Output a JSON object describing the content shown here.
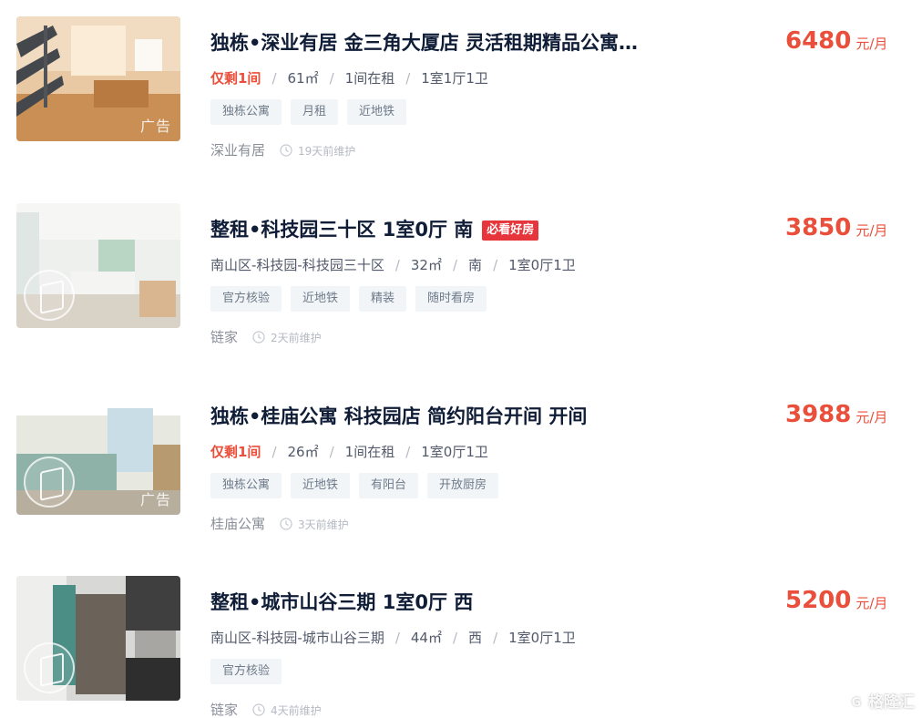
{
  "listings": [
    {
      "title": "独栋•深业有居 金三角大厦店 灵活租期精品公寓…",
      "badge": "",
      "desc_lead": "仅剩1间",
      "desc_parts": [
        "61㎡",
        "1间在租",
        "1室1厅1卫"
      ],
      "tags": [
        "独栋公寓",
        "月租",
        "近地铁"
      ],
      "brand": "深业有居",
      "maintain": "19天前维护",
      "price": "6480",
      "unit": "元/月",
      "ad_label": "广告",
      "has_vr": false
    },
    {
      "title": "整租•科技园三十区 1室0厅 南",
      "badge": "必看好房",
      "desc_lead": "",
      "desc_parts": [
        "南山区-科技园-科技园三十区",
        "32㎡",
        "南",
        "1室0厅1卫"
      ],
      "tags": [
        "官方核验",
        "近地铁",
        "精装",
        "随时看房"
      ],
      "brand": "链家",
      "maintain": "2天前维护",
      "price": "3850",
      "unit": "元/月",
      "ad_label": "",
      "has_vr": true
    },
    {
      "title": "独栋•桂庙公寓 科技园店 简约阳台开间 开间",
      "badge": "",
      "desc_lead": "仅剩1间",
      "desc_parts": [
        "26㎡",
        "1间在租",
        "1室0厅1卫"
      ],
      "tags": [
        "独栋公寓",
        "近地铁",
        "有阳台",
        "开放厨房"
      ],
      "brand": "桂庙公寓",
      "maintain": "3天前维护",
      "price": "3988",
      "unit": "元/月",
      "ad_label": "广告",
      "has_vr": true
    },
    {
      "title": "整租•城市山谷三期 1室0厅 西",
      "badge": "",
      "desc_lead": "",
      "desc_parts": [
        "南山区-科技园-城市山谷三期",
        "44㎡",
        "西",
        "1室0厅1卫"
      ],
      "tags": [
        "官方核验"
      ],
      "brand": "链家",
      "maintain": "4天前维护",
      "price": "5200",
      "unit": "元/月",
      "ad_label": "",
      "has_vr": true
    }
  ],
  "watermark": {
    "glyph": "G",
    "text": "格隆汇"
  },
  "colors": {
    "price": "#e94f3a",
    "badge": "#e6363c",
    "title": "#101d37",
    "tag_bg": "#f2f5f7"
  },
  "icons": {
    "maintain": "clock-icon",
    "thumb_vr": "vr-view-icon"
  }
}
